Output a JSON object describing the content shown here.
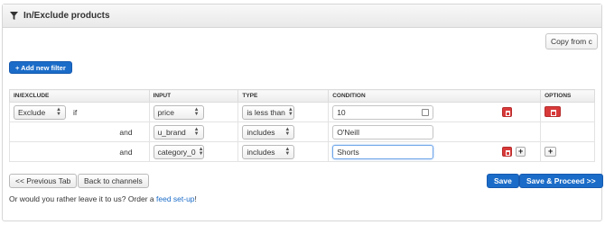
{
  "panel": {
    "title": "In/Exclude products"
  },
  "copy_from": {
    "label": "Copy from c"
  },
  "add_filter": {
    "label": "+ Add new filter"
  },
  "table": {
    "headers": [
      "IN/EXCLUDE",
      "INPUT",
      "TYPE",
      "CONDITION",
      "OPTIONS"
    ],
    "rows": [
      {
        "mode": "Exclude",
        "connector": "if",
        "input": "price",
        "type": "is less than",
        "condition": "10"
      },
      {
        "connector": "and",
        "input": "u_brand",
        "type": "includes",
        "condition": "O'Neill"
      },
      {
        "connector": "and",
        "input": "category_0",
        "type": "includes",
        "condition": "Shorts"
      }
    ]
  },
  "buttons": {
    "prev_tab": "<< Previous Tab",
    "back": "Back to channels",
    "save": "Save",
    "save_proceed": "Save & Proceed >>"
  },
  "footer": {
    "text": "Or would you rather leave it to us? Order a ",
    "link": "feed set-up",
    "suffix": "!"
  },
  "icons": {
    "panel": "filter-funnel-icon",
    "delete": "trash-icon",
    "add_condition": "plus-icon"
  },
  "colors": {
    "primary": "#1b6cc8",
    "danger": "#d83a3a"
  }
}
